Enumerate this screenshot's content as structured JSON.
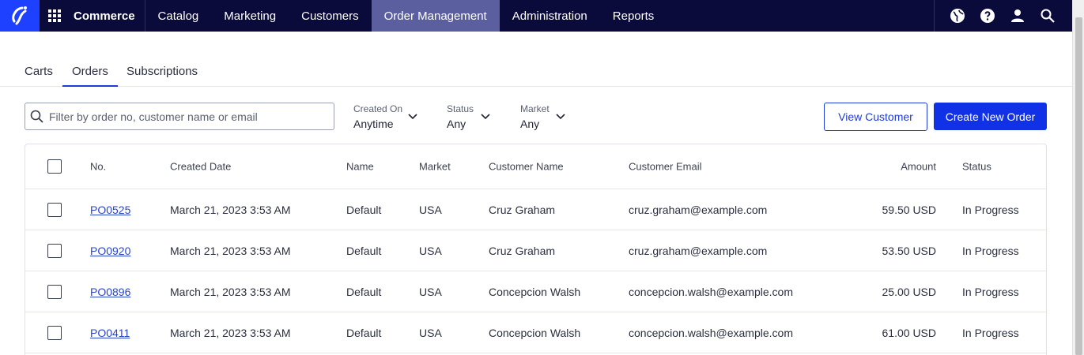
{
  "topnav": {
    "brand": "Commerce",
    "items": [
      {
        "label": "Catalog",
        "name": "nav-catalog"
      },
      {
        "label": "Marketing",
        "name": "nav-marketing"
      },
      {
        "label": "Customers",
        "name": "nav-customers"
      },
      {
        "label": "Order Management",
        "name": "nav-order-management",
        "active": true
      },
      {
        "label": "Administration",
        "name": "nav-administration"
      },
      {
        "label": "Reports",
        "name": "nav-reports"
      }
    ],
    "icons": [
      "globe-icon",
      "help-icon",
      "user-icon",
      "search-icon"
    ],
    "colors": {
      "bar": "#0b0b3b",
      "active": "#5b5f9f",
      "logo": "#1e40ff"
    }
  },
  "subtabs": [
    {
      "label": "Carts"
    },
    {
      "label": "Orders",
      "active": true
    },
    {
      "label": "Subscriptions"
    }
  ],
  "filters": {
    "search_placeholder": "Filter by order no, customer name or email",
    "created_on": {
      "label": "Created On",
      "value": "Anytime"
    },
    "status": {
      "label": "Status",
      "value": "Any"
    },
    "market": {
      "label": "Market",
      "value": "Any"
    }
  },
  "actions": {
    "view_customer": "View Customer",
    "create_order": "Create New Order"
  },
  "table": {
    "columns": [
      "No.",
      "Created Date",
      "Name",
      "Market",
      "Customer Name",
      "Customer Email",
      "Amount",
      "Status"
    ],
    "rows": [
      {
        "no": "PO0525",
        "created": "March 21, 2023 3:53 AM",
        "name": "Default",
        "market": "USA",
        "customer": "Cruz Graham",
        "email": "cruz.graham@example.com",
        "amount": "59.50 USD",
        "status": "In Progress"
      },
      {
        "no": "PO0920",
        "created": "March 21, 2023 3:53 AM",
        "name": "Default",
        "market": "USA",
        "customer": "Cruz Graham",
        "email": "cruz.graham@example.com",
        "amount": "53.50 USD",
        "status": "In Progress"
      },
      {
        "no": "PO0896",
        "created": "March 21, 2023 3:53 AM",
        "name": "Default",
        "market": "USA",
        "customer": "Concepcion Walsh",
        "email": "concepcion.walsh@example.com",
        "amount": "25.00 USD",
        "status": "In Progress"
      },
      {
        "no": "PO0411",
        "created": "March 21, 2023 3:53 AM",
        "name": "Default",
        "market": "USA",
        "customer": "Concepcion Walsh",
        "email": "concepcion.walsh@example.com",
        "amount": "61.00 USD",
        "status": "In Progress"
      }
    ]
  }
}
